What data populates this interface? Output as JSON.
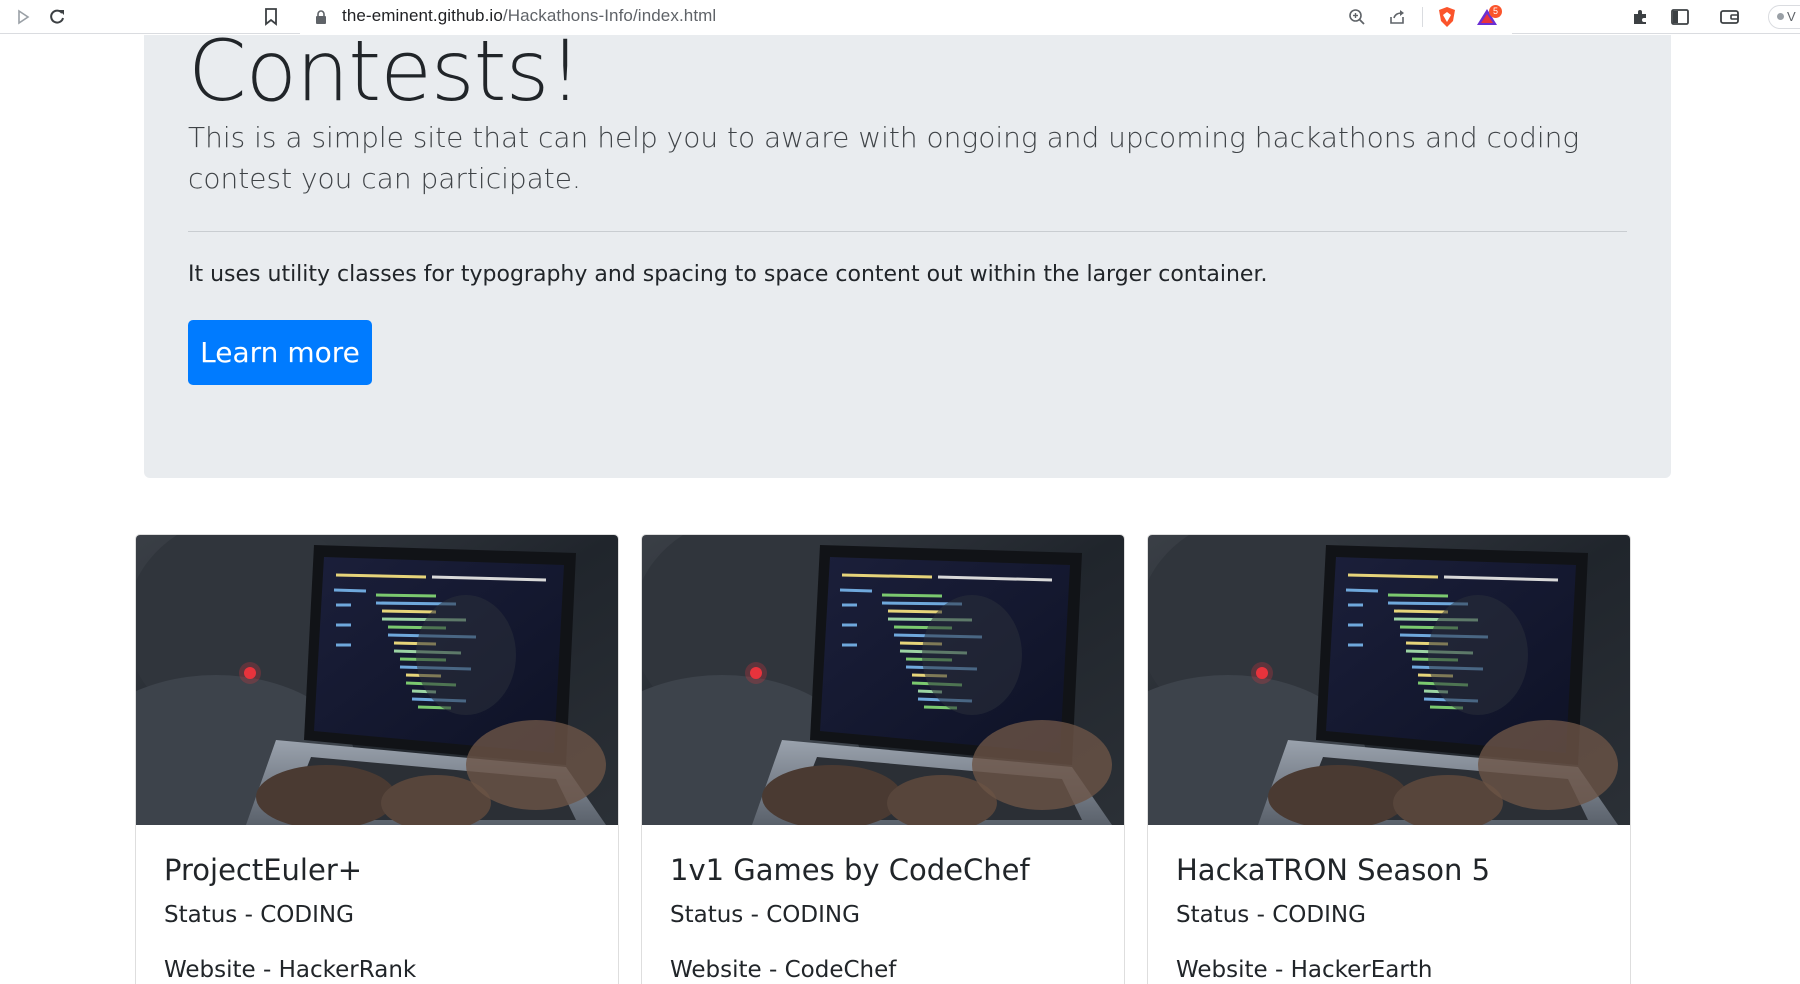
{
  "browser": {
    "url_domain": "the-eminent.github.io",
    "url_path": "/Hackathons-Info/index.html",
    "shields_badge": "5",
    "profile_label": "V"
  },
  "jumbotron": {
    "title": "Contests!",
    "lead": "This is a simple site that can help you to aware with ongoing and upcoming hackathons and coding contest you can participate.",
    "text": "It uses utility classes for typography and spacing to space content out within the larger container.",
    "button_label": "Learn more"
  },
  "cards": [
    {
      "title": "ProjectEuler+",
      "status": "Status - CODING",
      "website": "Website - HackerRank"
    },
    {
      "title": "1v1 Games by CodeChef",
      "status": "Status - CODING",
      "website": "Website - CodeChef"
    },
    {
      "title": "HackaTRON Season 5",
      "status": "Status - CODING",
      "website": "Website - HackerEarth"
    }
  ],
  "colors": {
    "primary": "#007bff",
    "jumbotron_bg": "#e9ecef",
    "brave_orange": "#fb542b"
  },
  "icons": [
    "play-icon",
    "reload-icon",
    "bookmark-icon",
    "lock-icon",
    "zoom-icon",
    "share-icon",
    "brave-shield-icon",
    "brave-rewards-icon",
    "extensions-icon",
    "sidebar-icon",
    "wallet-icon"
  ]
}
